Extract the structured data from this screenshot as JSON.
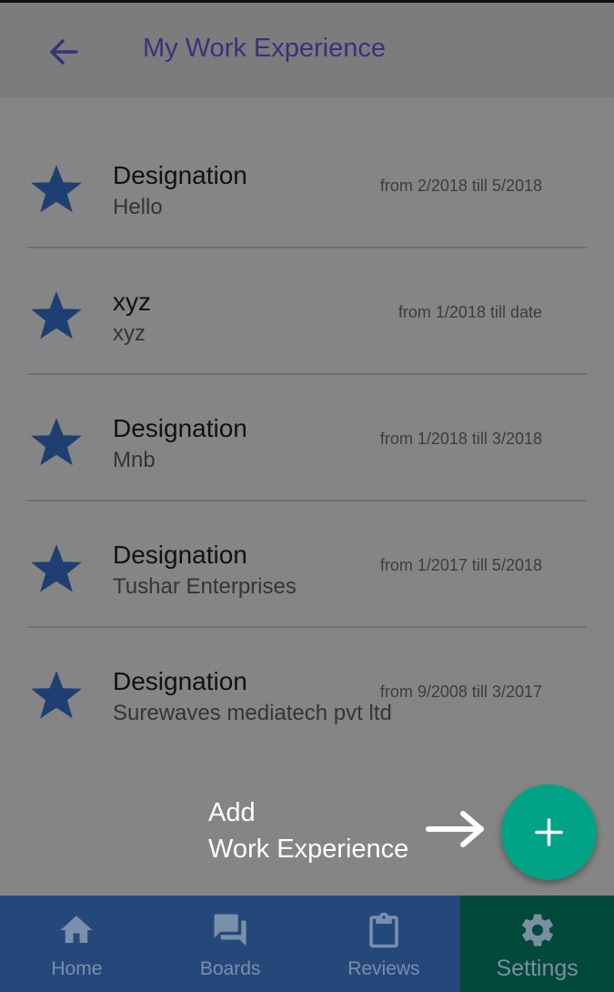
{
  "header": {
    "title": "My Work Experience",
    "back_icon": "arrow-left-icon"
  },
  "experiences": [
    {
      "title": "Designation",
      "subtitle": "Hello",
      "dates": "from 2/2018 till 5/2018"
    },
    {
      "title": "xyz",
      "subtitle": "xyz",
      "dates": "from 1/2018 till date"
    },
    {
      "title": "Designation",
      "subtitle": "Mnb",
      "dates": "from 1/2018 till 3/2018"
    },
    {
      "title": "Designation",
      "subtitle": "Tushar Enterprises",
      "dates": "from 1/2017 till 5/2018"
    },
    {
      "title": "Designation",
      "subtitle": "Surewaves mediatech pvt ltd",
      "dates": "from 9/2008 till 3/2017"
    }
  ],
  "hint": {
    "line1": "Add",
    "line2": "Work Experience"
  },
  "fab": {
    "icon": "plus-icon"
  },
  "nav": [
    {
      "label": "Home",
      "icon": "home-icon",
      "active": false
    },
    {
      "label": "Boards",
      "icon": "boards-icon",
      "active": false
    },
    {
      "label": "Reviews",
      "icon": "clipboard-icon",
      "active": false
    },
    {
      "label": "Settings",
      "icon": "gear-icon",
      "active": true
    }
  ],
  "colors": {
    "primary": "#35347a",
    "star": "#1f3f73",
    "fab": "#00a386",
    "nav_bg": "#25487a",
    "nav_active_bg": "#01493a"
  }
}
